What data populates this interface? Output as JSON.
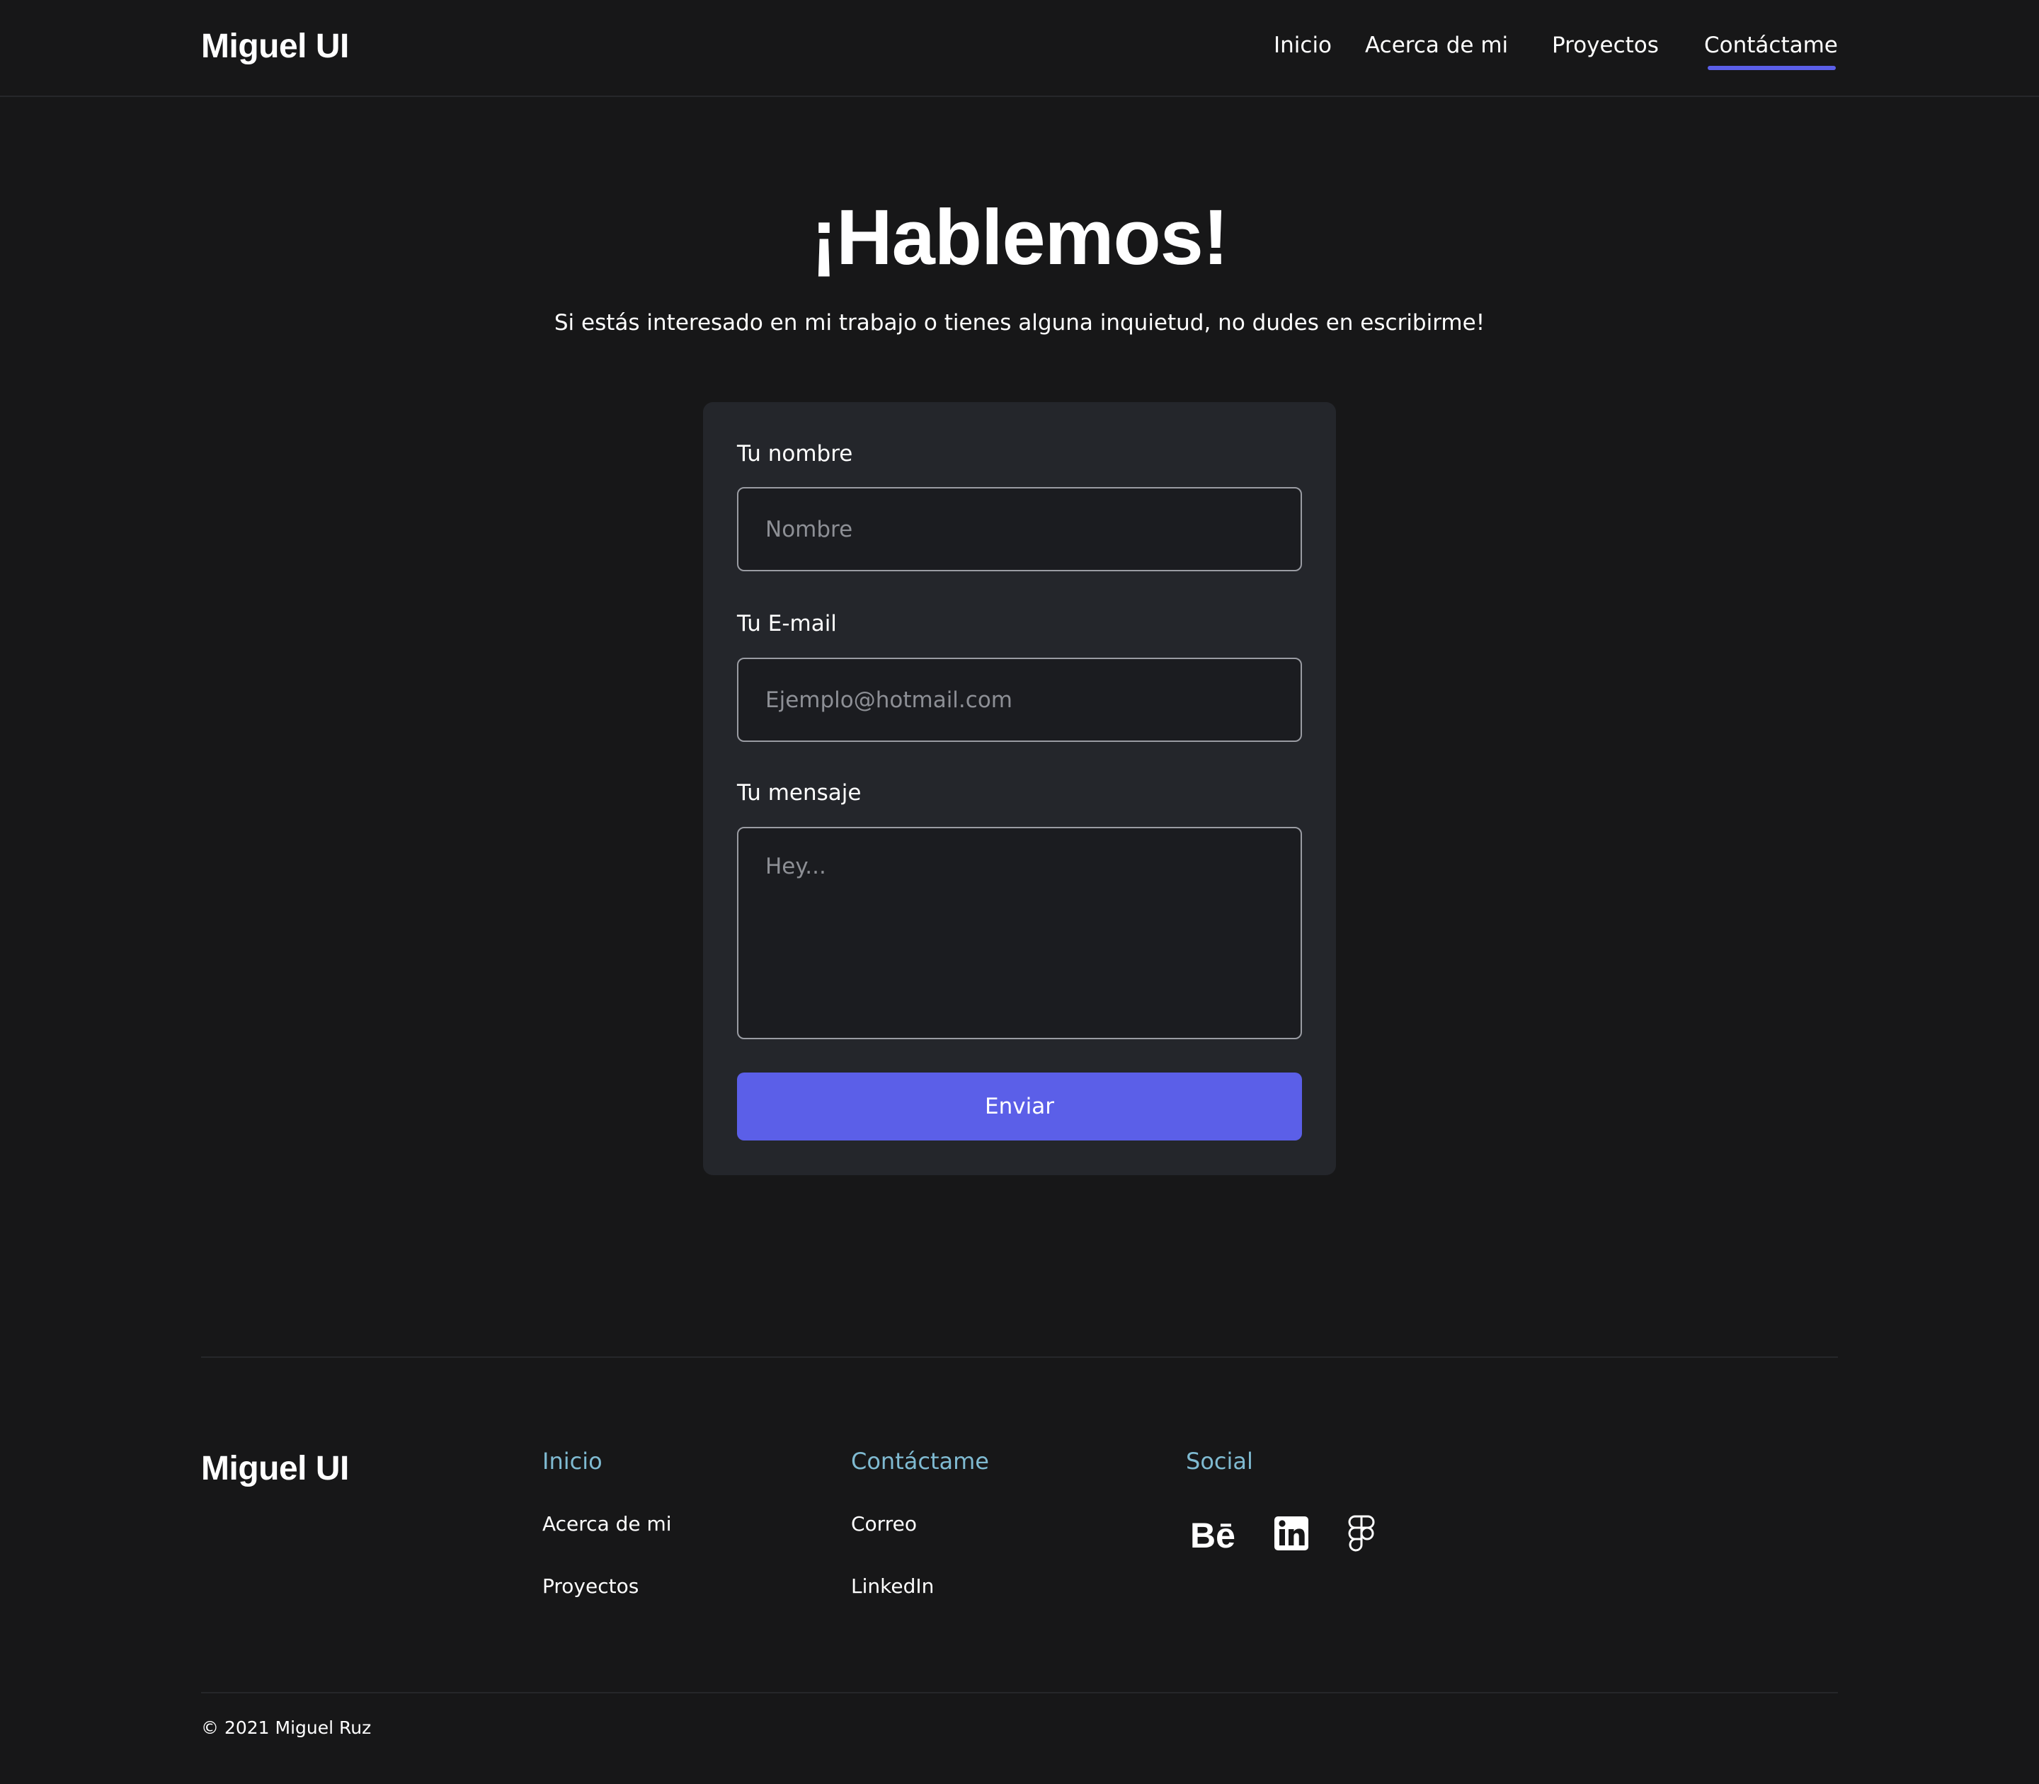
{
  "header": {
    "logo": "Miguel UI",
    "nav": [
      {
        "label": "Inicio"
      },
      {
        "label": "Acerca de mi"
      },
      {
        "label": "Proyectos"
      },
      {
        "label": "Contáctame",
        "active": true
      }
    ]
  },
  "hero": {
    "title": "¡Hablemos!",
    "subtitle": "Si estás interesado en mi trabajo o tienes alguna inquietud, no dudes en escribirme!"
  },
  "form": {
    "name_label": "Tu nombre",
    "name_placeholder": "Nombre",
    "email_label": "Tu E-mail",
    "email_placeholder": "Ejemplo@hotmail.com",
    "message_label": "Tu mensaje",
    "message_placeholder": "Hey...",
    "submit_label": "Enviar"
  },
  "footer": {
    "logo": "Miguel UI",
    "columns": [
      {
        "heading": "Inicio",
        "links": [
          "Acerca de mi",
          "Proyectos"
        ]
      },
      {
        "heading": "Contáctame",
        "links": [
          "Correo",
          "LinkedIn"
        ]
      },
      {
        "heading": "Social",
        "icons": [
          "behance-icon",
          "linkedin-icon",
          "figma-icon"
        ]
      }
    ],
    "copyright": "© 2021 Miguel Ruz"
  },
  "colors": {
    "background": "#171718",
    "card": "#24262b",
    "accent": "#5b5fe8",
    "footer_heading": "#7fbad1"
  }
}
